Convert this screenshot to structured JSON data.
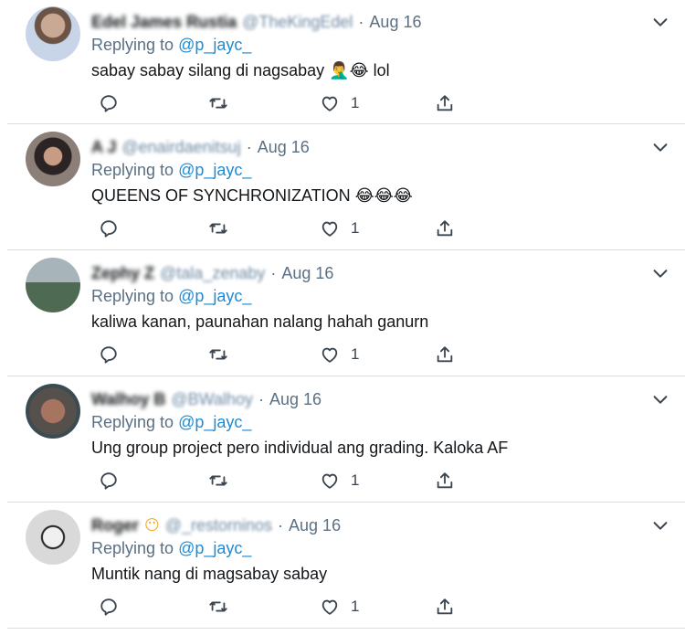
{
  "tweets": [
    {
      "name": "Edel James Rustia",
      "name_emoji": "",
      "handle": "@TheKingEdel",
      "date": "Aug 16",
      "replying_prefix": "Replying to ",
      "replying_to": "@p_jayc_",
      "text": "sabay sabay silang di nagsabay 🤦‍♂️😂 lol",
      "likes": "1"
    },
    {
      "name": "A J",
      "name_emoji": "",
      "handle": "@enairdaenitsuj",
      "date": "Aug 16",
      "replying_prefix": "Replying to ",
      "replying_to": "@p_jayc_",
      "text": "QUEENS OF SYNCHRONIZATION 😂😂😂",
      "likes": "1"
    },
    {
      "name": "Zephy Z",
      "name_emoji": "",
      "handle": "@tala_zenaby",
      "date": "Aug 16",
      "replying_prefix": "Replying to ",
      "replying_to": "@p_jayc_",
      "text": "kaliwa kanan, paunahan nalang hahah ganurn",
      "likes": "1"
    },
    {
      "name": "Walhoy B",
      "name_emoji": "",
      "handle": "@BWalhoy",
      "date": "Aug 16",
      "replying_prefix": "Replying to ",
      "replying_to": "@p_jayc_",
      "text": "Ung group project pero individual ang grading. Kaloka AF",
      "likes": "1"
    },
    {
      "name": "Roger",
      "name_emoji": "😶",
      "handle": "@_restorninos",
      "date": "Aug 16",
      "replying_prefix": "Replying to ",
      "replying_to": "@p_jayc_",
      "text": "Muntik nang di magsabay sabay",
      "likes": "1"
    }
  ],
  "separator": "·",
  "icons": {
    "reply": "reply-icon",
    "retweet": "retweet-icon",
    "like": "like-icon",
    "share": "share-icon",
    "more": "chevron-down-icon"
  },
  "colors": {
    "mention": "#1d8bd6",
    "muted": "#5b7083",
    "text": "#14171a"
  }
}
